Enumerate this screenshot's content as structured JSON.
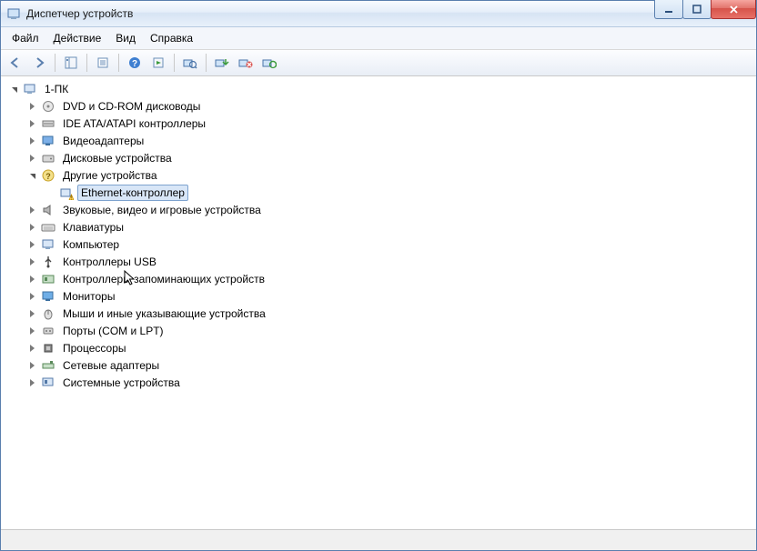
{
  "window": {
    "title": "Диспетчер устройств"
  },
  "menu": {
    "file": "Файл",
    "action": "Действие",
    "view": "Вид",
    "help": "Справка"
  },
  "tree": {
    "root": "1-ПК",
    "nodes": {
      "dvd": "DVD и CD-ROM дисководы",
      "ide": "IDE ATA/ATAPI контроллеры",
      "video": "Видеоадаптеры",
      "disk": "Дисковые устройства",
      "other": "Другие устройства",
      "eth": "Ethernet-контроллер",
      "sound": "Звуковые, видео и игровые устройства",
      "kbd": "Клавиатуры",
      "comp": "Компьютер",
      "usb": "Контроллеры USB",
      "storctl": "Контроллеры запоминающих устройств",
      "mon": "Мониторы",
      "mouse": "Мыши и иные указывающие устройства",
      "ports": "Порты (COM и LPT)",
      "cpu": "Процессоры",
      "net": "Сетевые адаптеры",
      "sys": "Системные устройства"
    }
  }
}
